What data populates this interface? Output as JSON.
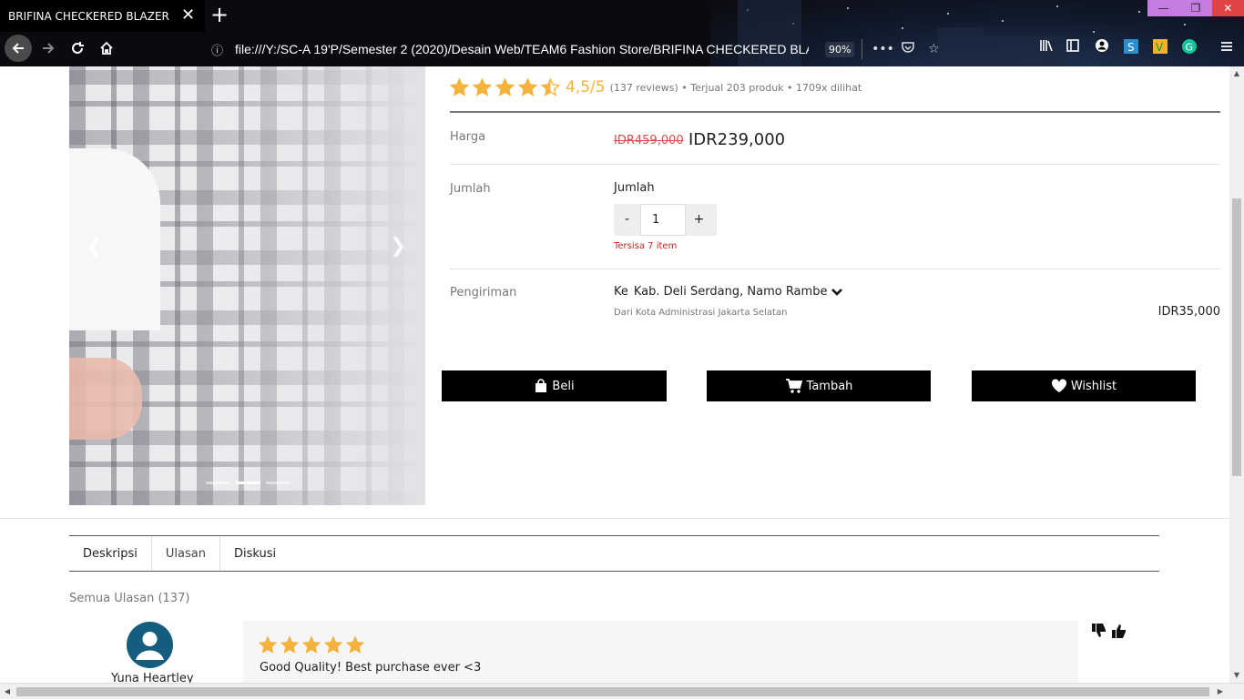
{
  "browser": {
    "tab_title": "BRIFINA CHECKERED BLAZER",
    "url": "file:///Y:/SC-A 19'P/Semester 2 (2020)/Desain Web/TEAM6 Fashion Store/BRIFINA CHECKERED BLAZER",
    "zoom": "90%"
  },
  "product": {
    "rating_score": "4,5/5",
    "rating_value": 4.5,
    "rating_meta": "(137 reviews) • Terjual 203 produk • 1709x dilihat",
    "price_label": "Harga",
    "old_price": "IDR459,000",
    "new_price": "IDR239,000",
    "qty_label": "Jumlah",
    "qty_title": "Jumlah",
    "qty_minus": "-",
    "qty_plus": "+",
    "qty_value": "1",
    "stock": "Tersisa 7 item",
    "ship_label": "Pengiriman",
    "ship_prefix": "Ke",
    "ship_to": "Kab. Deli Serdang, Namo Rambe",
    "ship_from": "Dari Kota Administrasi Jakarta Selatan",
    "ship_cost": "IDR35,000"
  },
  "actions": {
    "buy": "Beli",
    "add": "Tambah",
    "wishlist": "Wishlist"
  },
  "tabs": [
    "Deskripsi",
    "Ulasan",
    "Diskusi"
  ],
  "active_tab": "Ulasan",
  "reviews": {
    "heading": "Semua Ulasan (137)",
    "items": [
      {
        "name": "Yuna Heartley",
        "stars": 5,
        "text": "Good Quality! Best purchase ever <3"
      }
    ]
  },
  "colors": {
    "star": "#f4b33c",
    "old_price": "#e04b4b",
    "stock": "#c01f1f",
    "button": "#000000",
    "avatar": "#155d7e"
  }
}
